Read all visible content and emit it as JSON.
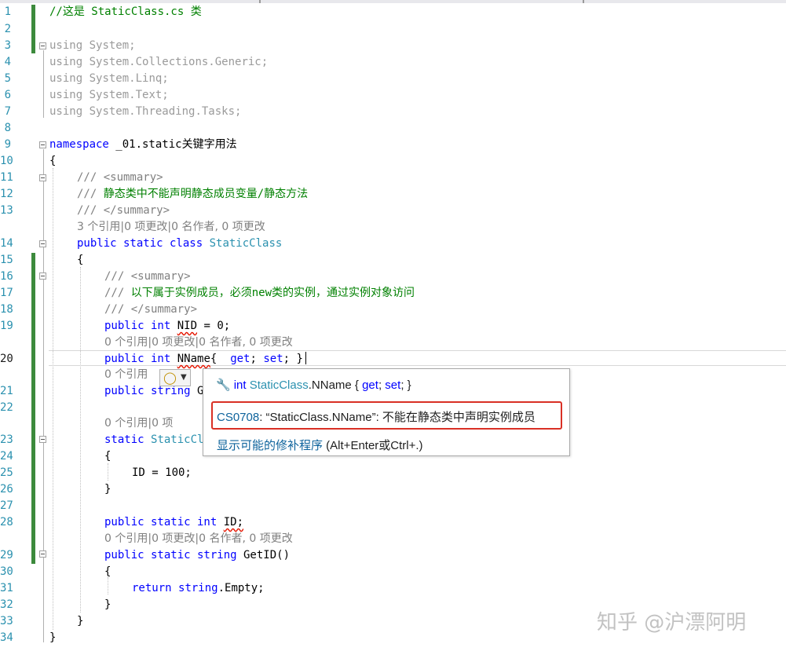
{
  "line_numbers": [
    "1",
    "2",
    "3",
    "4",
    "5",
    "6",
    "7",
    "8",
    "9",
    "10",
    "11",
    "12",
    "13",
    "14",
    "15",
    "16",
    "17",
    "18",
    "19",
    "20",
    "21",
    "22",
    "23",
    "24",
    "25",
    "26",
    "27",
    "28",
    "29",
    "30",
    "31",
    "32",
    "33",
    "34"
  ],
  "code": {
    "l1": "//这是 StaticClass.cs 类",
    "l3_kw": "using",
    "l3_rest": " System;",
    "l4_kw": "using",
    "l4_rest": " System.Collections.Generic;",
    "l5_kw": "using",
    "l5_rest": " System.Linq;",
    "l6_kw": "using",
    "l6_rest": " System.Text;",
    "l7_kw": "using",
    "l7_rest": " System.Threading.Tasks;",
    "l9_kw": "namespace",
    "l9_rest": " _01.static关键字用法",
    "l10": "{",
    "l11_a": "/// ",
    "l11_b": "<summary>",
    "l12_a": "/// ",
    "l12_b": "静态类中不能声明静态成员变量/静态方法",
    "l13_a": "/// ",
    "l13_b": "</summary>",
    "lens1": "3 个引用|0 项更改|0 名作者, 0 项更改",
    "l14_kw": "public static class",
    "l14_type": "StaticClass",
    "l15": "{",
    "l16_a": "/// ",
    "l16_b": "<summary>",
    "l17_a": "/// ",
    "l17_b": "以下属于实例成员，必须new类的实例，通过实例对象访问",
    "l18_a": "/// ",
    "l18_b": "</summary>",
    "l19_kw": "public int",
    "l19_id": "NID",
    "l19_rest": " = 0;",
    "lens2": "0 个引用|0 项更改|0 名作者, 0 项更改",
    "l20_kw": "public int",
    "l20_id": "NName",
    "l20_p1": "{  ",
    "l20_get": "get",
    "l20_p2": "; ",
    "l20_set": "set",
    "l20_p3": "; }",
    "lens3": "0 个引用",
    "l21_kw": "public string",
    "l21_rest": " G",
    "lens4": "0 个引用|0 项",
    "l23_kw": "static",
    "l23_type": "StaticCl",
    "l24": "{",
    "l25": "ID = 100;",
    "l26": "}",
    "l28_kw": "public static int",
    "l28_id": "ID;",
    "lens5": "0 个引用|0 项更改|0 名作者, 0 项更改",
    "l29_kw": "public static string",
    "l29_rest": " GetID()",
    "l30": "{",
    "l31_kw": "return",
    "l31_type": "string",
    "l31_rest": ".Empty;",
    "l32": "}",
    "l33": "}",
    "l34": "}"
  },
  "quick_actions": {
    "bulb_icon": "lightbulb-icon",
    "arrow_icon": "chevron-down-icon"
  },
  "tooltip": {
    "sig_kw": "int",
    "sig_type": "StaticClass",
    "sig_rest": ".NName { ",
    "sig_get": "get",
    "sig_sep": "; ",
    "sig_set": "set",
    "sig_end": "; }",
    "error_code": "CS0708",
    "error_message": ": “StaticClass.NName”: 不能在静态类中声明实例成员",
    "fix_link": "显示可能的修补程序",
    "fix_shortcut": " (Alt+Enter或Ctrl+.)"
  },
  "watermark": "知乎 @沪漂阿明",
  "colors": {
    "keyword": "#0000ff",
    "type": "#2b91af",
    "comment": "#008000",
    "error_border": "#d93025",
    "change_bar": "#3c8a3c"
  }
}
